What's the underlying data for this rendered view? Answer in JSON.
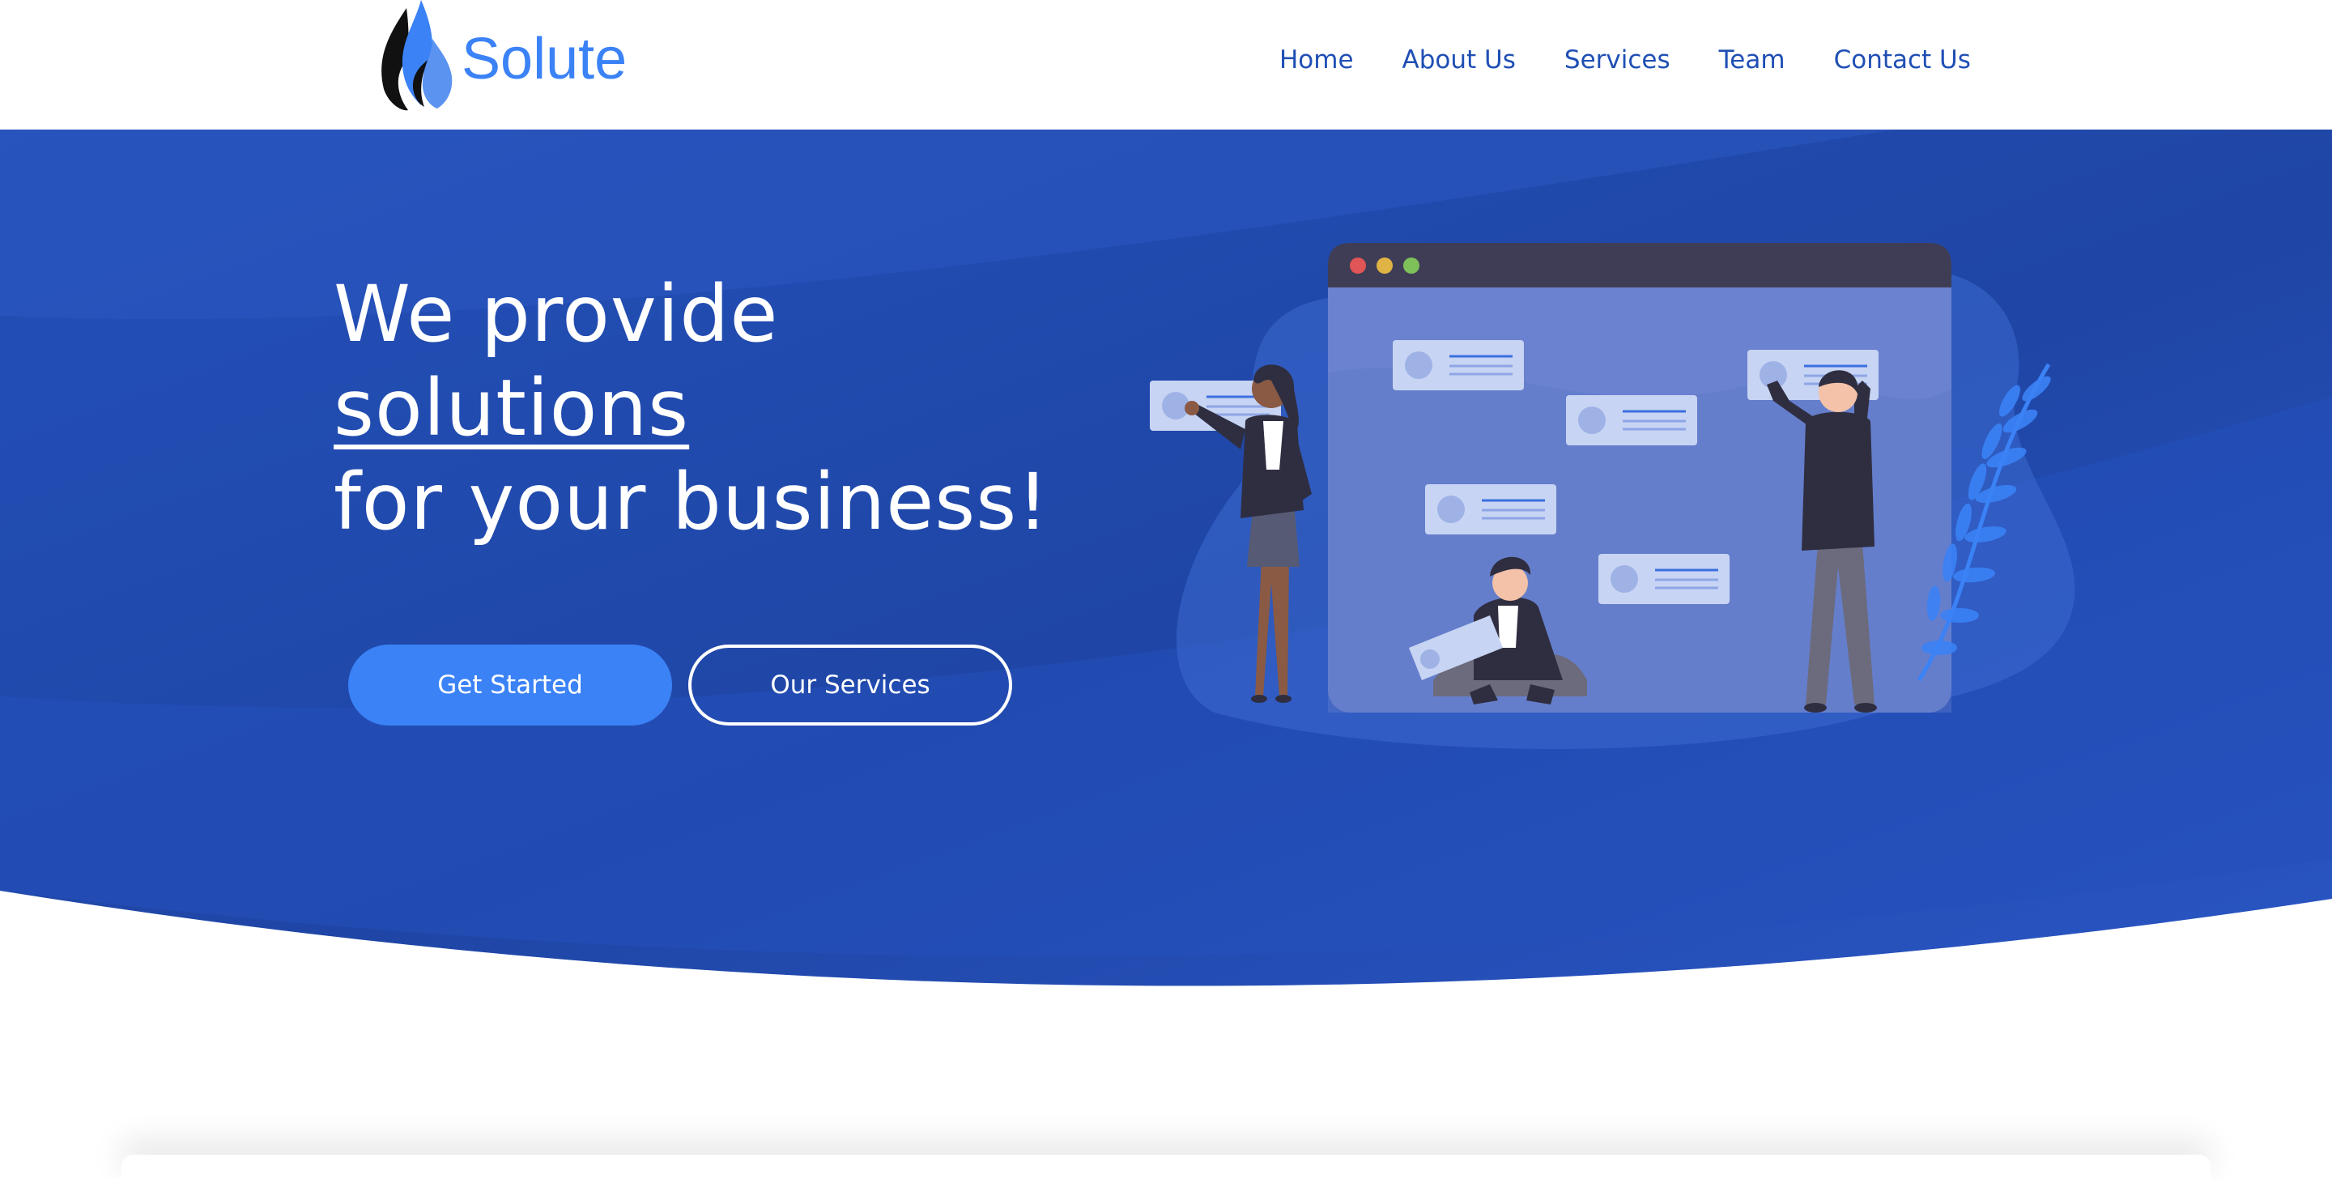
{
  "brand": {
    "name": "Solute",
    "logo_icon": "flame-logo-icon"
  },
  "nav": {
    "items": [
      "Home",
      "About Us",
      "Services",
      "Team",
      "Contact Us"
    ]
  },
  "hero": {
    "title_line1": "We provide",
    "title_line2": "solutions",
    "title_line3": "for your business!",
    "primary_button": "Get Started",
    "secondary_button": "Our Services",
    "illustration_icon": "team-dashboard-illustration-icon"
  },
  "colors": {
    "header_bg": "#ffffff",
    "hero_bg": "#244fb6",
    "hero_bg_dark": "#1f46a6",
    "accent": "#3b82f6",
    "nav_text": "#1f4fb4",
    "hero_text": "#ffffff",
    "window_bar": "#3f3d56",
    "window_body": "#6b82d0",
    "card": "#c7d4f3",
    "dot_red": "#e05555",
    "dot_yellow": "#e0b444",
    "dot_green": "#7ec05a"
  }
}
